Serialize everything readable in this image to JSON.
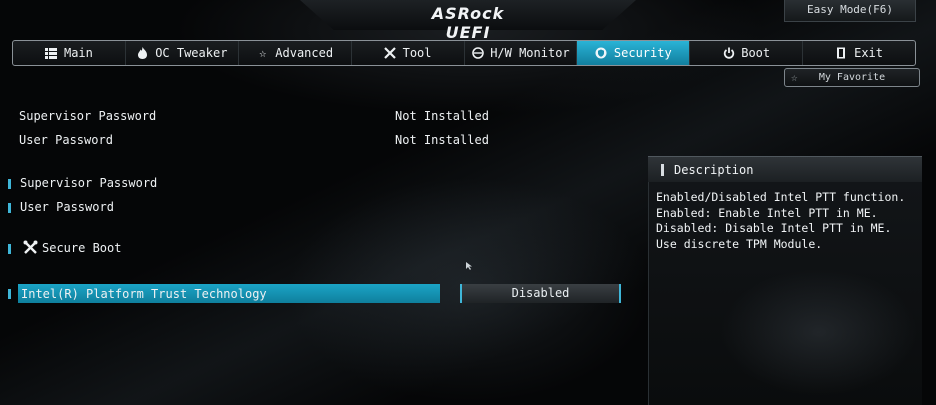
{
  "header": {
    "brand": "ASRock UEFI",
    "easy_mode": "Easy Mode(F6)"
  },
  "tabs": [
    {
      "label": "Main",
      "icon": "list-icon",
      "active": false
    },
    {
      "label": "OC Tweaker",
      "icon": "flame-icon",
      "active": false
    },
    {
      "label": "Advanced",
      "icon": "star-icon",
      "active": false
    },
    {
      "label": "Tool",
      "icon": "wrench-icon",
      "active": false
    },
    {
      "label": "H/W Monitor",
      "icon": "monitor-icon",
      "active": false
    },
    {
      "label": "Security",
      "icon": "shield-icon",
      "active": true
    },
    {
      "label": "Boot",
      "icon": "power-icon",
      "active": false
    },
    {
      "label": "Exit",
      "icon": "exit-icon",
      "active": false
    }
  ],
  "favorite": {
    "label": "My Favorite"
  },
  "status": {
    "supervisor_label": "Supervisor Password",
    "supervisor_value": "Not Installed",
    "user_label": "User Password",
    "user_value": "Not Installed"
  },
  "items": {
    "supervisor_password": "Supervisor Password",
    "user_password": "User Password",
    "secure_boot": "Secure Boot",
    "ptt": "Intel(R) Platform Trust Technology",
    "ptt_value": "Disabled"
  },
  "description": {
    "title": "Description",
    "text": "Enabled/Disabled Intel PTT function.\nEnabled: Enable Intel PTT in ME.\nDisabled: Disable Intel PTT in ME. Use discrete TPM Module."
  },
  "colors": {
    "accent": "#1ba4c6",
    "marker": "#3fb6d8"
  }
}
